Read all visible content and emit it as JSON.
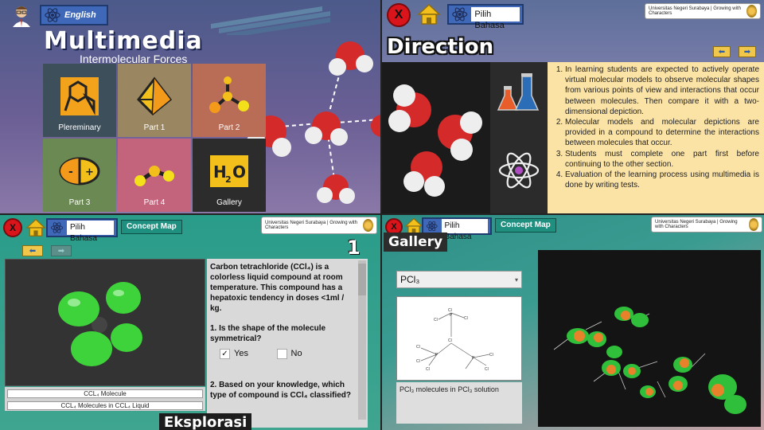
{
  "quadrant1": {
    "language_label": "English",
    "title": "Multimedia",
    "subtitle": "Intermolecular Forces",
    "menu": [
      {
        "label": "Plereminary",
        "color": "#3d4f5a",
        "icon": "benzene-icon"
      },
      {
        "label": "Part 1",
        "color": "#9a8660",
        "icon": "tetrahedron-icon"
      },
      {
        "label": "Part 2",
        "color": "#b96c56",
        "icon": "molecule-part2-icon"
      },
      {
        "label": "Part 3",
        "color": "#6b8a53",
        "icon": "dipole-icon"
      },
      {
        "label": "Part 4",
        "color": "#c4647c",
        "icon": "bond-icon"
      },
      {
        "label": "Gallery",
        "color": "#2c2c2c",
        "icon": "water-h2o-icon"
      }
    ],
    "gallery_icon_text": {
      "h": "H",
      "sub": "2",
      "o": "O"
    }
  },
  "quadrant2": {
    "close_label": "X",
    "language_field": "Pilih Bahasa",
    "univ_badge": "Universitas Negeri Surabaya | Growing with Characters",
    "title": "Direction",
    "prev_arrow": "⬅",
    "next_arrow": "➡",
    "directions": [
      "In learning students are expected to actively operate virtual molecular models to observe molecular shapes from various points of view and interactions that occur between molecules. Then compare it with a two-dimensional depiction.",
      "Molecular models and molecular depictions are provided in a compound to determine the interactions between molecules that occur.",
      "Students must complete one part first before continuing to the other section.",
      "Evaluation of the learning process using multimedia is done by writing tests."
    ]
  },
  "quadrant3": {
    "close_label": "X",
    "language_field": "Pilih Bahasa",
    "concept_map": "Concept Map",
    "univ_badge": "Universitas Negeri Surabaya | Growing with Characters",
    "page_number": "1",
    "prev_arrow": "⬅",
    "next_arrow": "➡",
    "labels": [
      "CCL₄ Molecule",
      "CCL₄ Molecules in CCL₄ Liquid"
    ],
    "intro": "Carbon tetrachloride (CCl₄) is a colorless liquid compound at room temperature. This compound has a hepatoxic tendency in doses <1ml / kg.",
    "q1": "1. Is the shape of the molecule symmetrical?",
    "answer_yes": "Yes",
    "answer_no": "No",
    "yes_checked": "✓",
    "q2": "2. Based on your knowledge, which type of compound is CCl₄ classified?",
    "footer": "Eksplorasi"
  },
  "quadrant4": {
    "close_label": "X",
    "language_field": "Pilih Bahasa",
    "concept_map": "Concept Map",
    "univ_badge": "Universitas Negeri Surabaya | Growing with Characters",
    "title": "Gallery",
    "select_value": "PCl₃",
    "caption": "PCl₃ molecules in PCl₃ solution",
    "diagram_labels": [
      "Cl",
      "P",
      "Cl",
      "Cl",
      "Cl",
      "Cl",
      "P",
      "Cl",
      "Cl",
      "P",
      "Cl",
      "Cl"
    ]
  }
}
